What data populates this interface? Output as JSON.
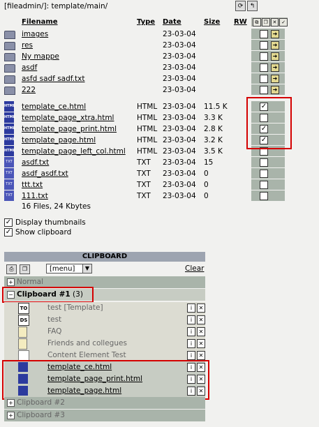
{
  "path": "[fileadmin/]: template/main/",
  "headers": {
    "filename": "Filename",
    "type": "Type",
    "date": "Date",
    "size": "Size",
    "rw": "RW"
  },
  "folders": [
    {
      "name": "images",
      "date": "23-03-04"
    },
    {
      "name": "res",
      "date": "23-03-04"
    },
    {
      "name": "Ny mappe",
      "date": "23-03-04"
    },
    {
      "name": "asdf",
      "date": "23-03-04"
    },
    {
      "name": "asfd sadf sadf.txt",
      "date": "23-03-04"
    },
    {
      "name": "222",
      "date": "23-03-04"
    }
  ],
  "files": [
    {
      "name": "template_ce.html",
      "type": "HTML",
      "date": "23-03-04",
      "size": "11.5 K",
      "checked": true,
      "icon": "HTML"
    },
    {
      "name": "template_page_xtra.html",
      "type": "HTML",
      "date": "23-03-04",
      "size": "3.3 K",
      "checked": false,
      "icon": "HTML"
    },
    {
      "name": "template_page_print.html",
      "type": "HTML",
      "date": "23-03-04",
      "size": "2.8 K",
      "checked": true,
      "icon": "HTML"
    },
    {
      "name": "template_page.html",
      "type": "HTML",
      "date": "23-03-04",
      "size": "3.2 K",
      "checked": true,
      "icon": "HTML"
    },
    {
      "name": "template_page_left_col.html",
      "type": "HTML",
      "date": "23-03-04",
      "size": "3.5 K",
      "checked": false,
      "icon": "HTML"
    },
    {
      "name": "asdf.txt",
      "type": "TXT",
      "date": "23-03-04",
      "size": "15",
      "checked": false,
      "icon": "TXT"
    },
    {
      "name": "asdf_asdf.txt",
      "type": "TXT",
      "date": "23-03-04",
      "size": "0",
      "checked": false,
      "icon": "TXT"
    },
    {
      "name": "ttt.txt",
      "type": "TXT",
      "date": "23-03-04",
      "size": "0",
      "checked": false,
      "icon": "TXT"
    },
    {
      "name": "111.txt",
      "type": "TXT",
      "date": "23-03-04",
      "size": "0",
      "checked": false,
      "icon": "TXT"
    }
  ],
  "summary": "16 Files, 24 Kbytes",
  "options": {
    "thumbnails": "Display thumbnails",
    "clipboard": "Show clipboard"
  },
  "clipboard": {
    "title": "CLIPBOARD",
    "menu": "[menu]",
    "clear": "Clear",
    "normal": "Normal",
    "pad1": "Clipboard #1",
    "pad1_count": "(3)",
    "pad2": "Clipboard #2",
    "pad3": "Clipboard #3",
    "records": [
      {
        "label": "test [Template]",
        "icon": "TO"
      },
      {
        "label": "test",
        "icon": "DS"
      },
      {
        "label": "FAQ",
        "icon": "page"
      },
      {
        "label": "Friends and collegues",
        "icon": "page"
      },
      {
        "label": "Content Element Test",
        "icon": "content"
      }
    ],
    "files": [
      "template_ce.html",
      "template_page_print.html",
      "template_page.html"
    ]
  },
  "colors": {
    "highlight": "#d40000",
    "header_bg": "#9da4b0",
    "row_bg": "#a9b4aa"
  }
}
